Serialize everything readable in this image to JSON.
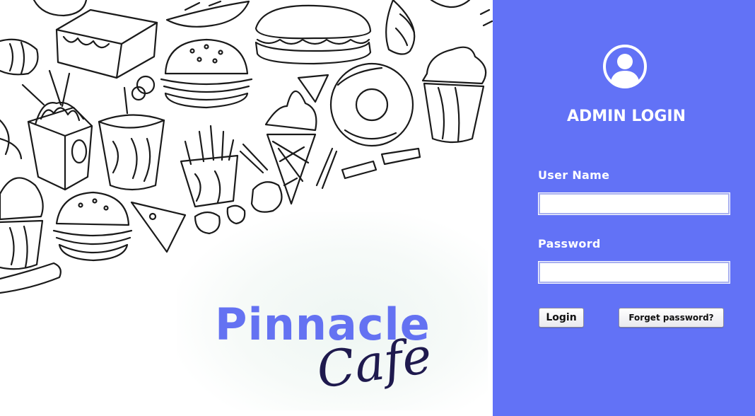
{
  "brand": {
    "name": "Pinnacle",
    "subtitle": "Cafe"
  },
  "login": {
    "title": "ADMIN LOGIN",
    "username_label": "User Name",
    "username_value": "",
    "password_label": "Password",
    "password_value": "",
    "login_button": "Login",
    "forgot_button": "Forget password?"
  },
  "icons": {
    "avatar": "user-circle-icon"
  },
  "colors": {
    "panel_accent": "#6272f6",
    "brand_primary": "#6472f2",
    "brand_secondary": "#1f1a4e"
  }
}
